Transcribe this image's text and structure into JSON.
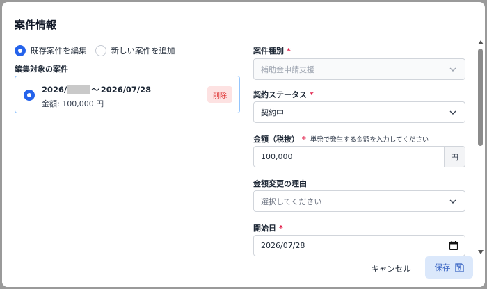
{
  "dialog": {
    "title": "案件情報"
  },
  "mode": {
    "options": [
      {
        "label": "既存案件を編集",
        "selected": true
      },
      {
        "label": "新しい案件を追加",
        "selected": false
      }
    ]
  },
  "target_case": {
    "section_label": "編集対象の案件",
    "period_start_prefix": "2026/",
    "period_separator": "〜",
    "period_end": "2026/07/28",
    "amount_text": "金額: 100,000 円",
    "delete_label": "削除"
  },
  "form": {
    "case_type": {
      "label": "案件種別",
      "required_mark": "*",
      "value": "補助金申請支援",
      "disabled": true
    },
    "contract_status": {
      "label": "契約ステータス",
      "required_mark": "*",
      "value": "契約中"
    },
    "amount": {
      "label": "金額（税抜）",
      "required_mark": "*",
      "hint": "単発で発生する金額を入力してください",
      "value": "100,000",
      "unit": "円"
    },
    "change_reason": {
      "label": "金額変更の理由",
      "placeholder": "選択してください"
    },
    "start_date": {
      "label": "開始日",
      "required_mark": "*",
      "value": "2026/07/28"
    }
  },
  "footer": {
    "cancel_label": "キャンセル",
    "save_label": "保存"
  },
  "colors": {
    "accent": "#2563eb",
    "required": "#e11d48",
    "delete_bg": "#fde2e2",
    "delete_text": "#dc2626",
    "save_bg": "#dbe8fb"
  }
}
